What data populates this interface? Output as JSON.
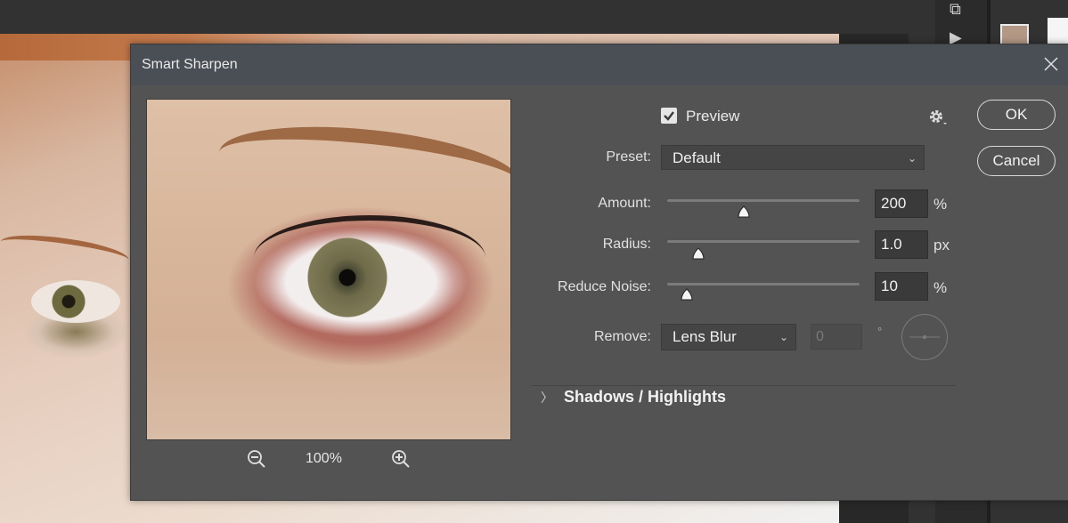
{
  "dialog": {
    "title": "Smart Sharpen",
    "preview_checkbox_label": "Preview",
    "preview_checked": true,
    "zoom_level": "100%",
    "buttons": {
      "ok": "OK",
      "cancel": "Cancel"
    },
    "preset": {
      "label": "Preset:",
      "value": "Default"
    },
    "amount": {
      "label": "Amount:",
      "value": "200",
      "unit": "%",
      "level": 0.4
    },
    "radius": {
      "label": "Radius:",
      "value": "1.0",
      "unit": "px",
      "level": 0.16
    },
    "reduce_noise": {
      "label": "Reduce Noise:",
      "value": "10",
      "unit": "%",
      "level": 0.1
    },
    "remove": {
      "label": "Remove:",
      "value": "Lens Blur",
      "angle_value": "0",
      "angle_unit": "°"
    },
    "shadows_highlights": {
      "label": "Shadows / Highlights",
      "expanded": false
    }
  },
  "colors": {
    "dialog_bg": "#535353",
    "titlebar_bg": "#4a4f55",
    "control_text": "#e0e0e0",
    "foreground_swatch": "#b39885"
  },
  "icons": [
    "close-icon",
    "gear-icon",
    "zoom-out-icon",
    "zoom-in-icon",
    "checkbox-checked-icon",
    "chevron-down-icon",
    "chevron-right-icon",
    "angle-dial-icon"
  ]
}
